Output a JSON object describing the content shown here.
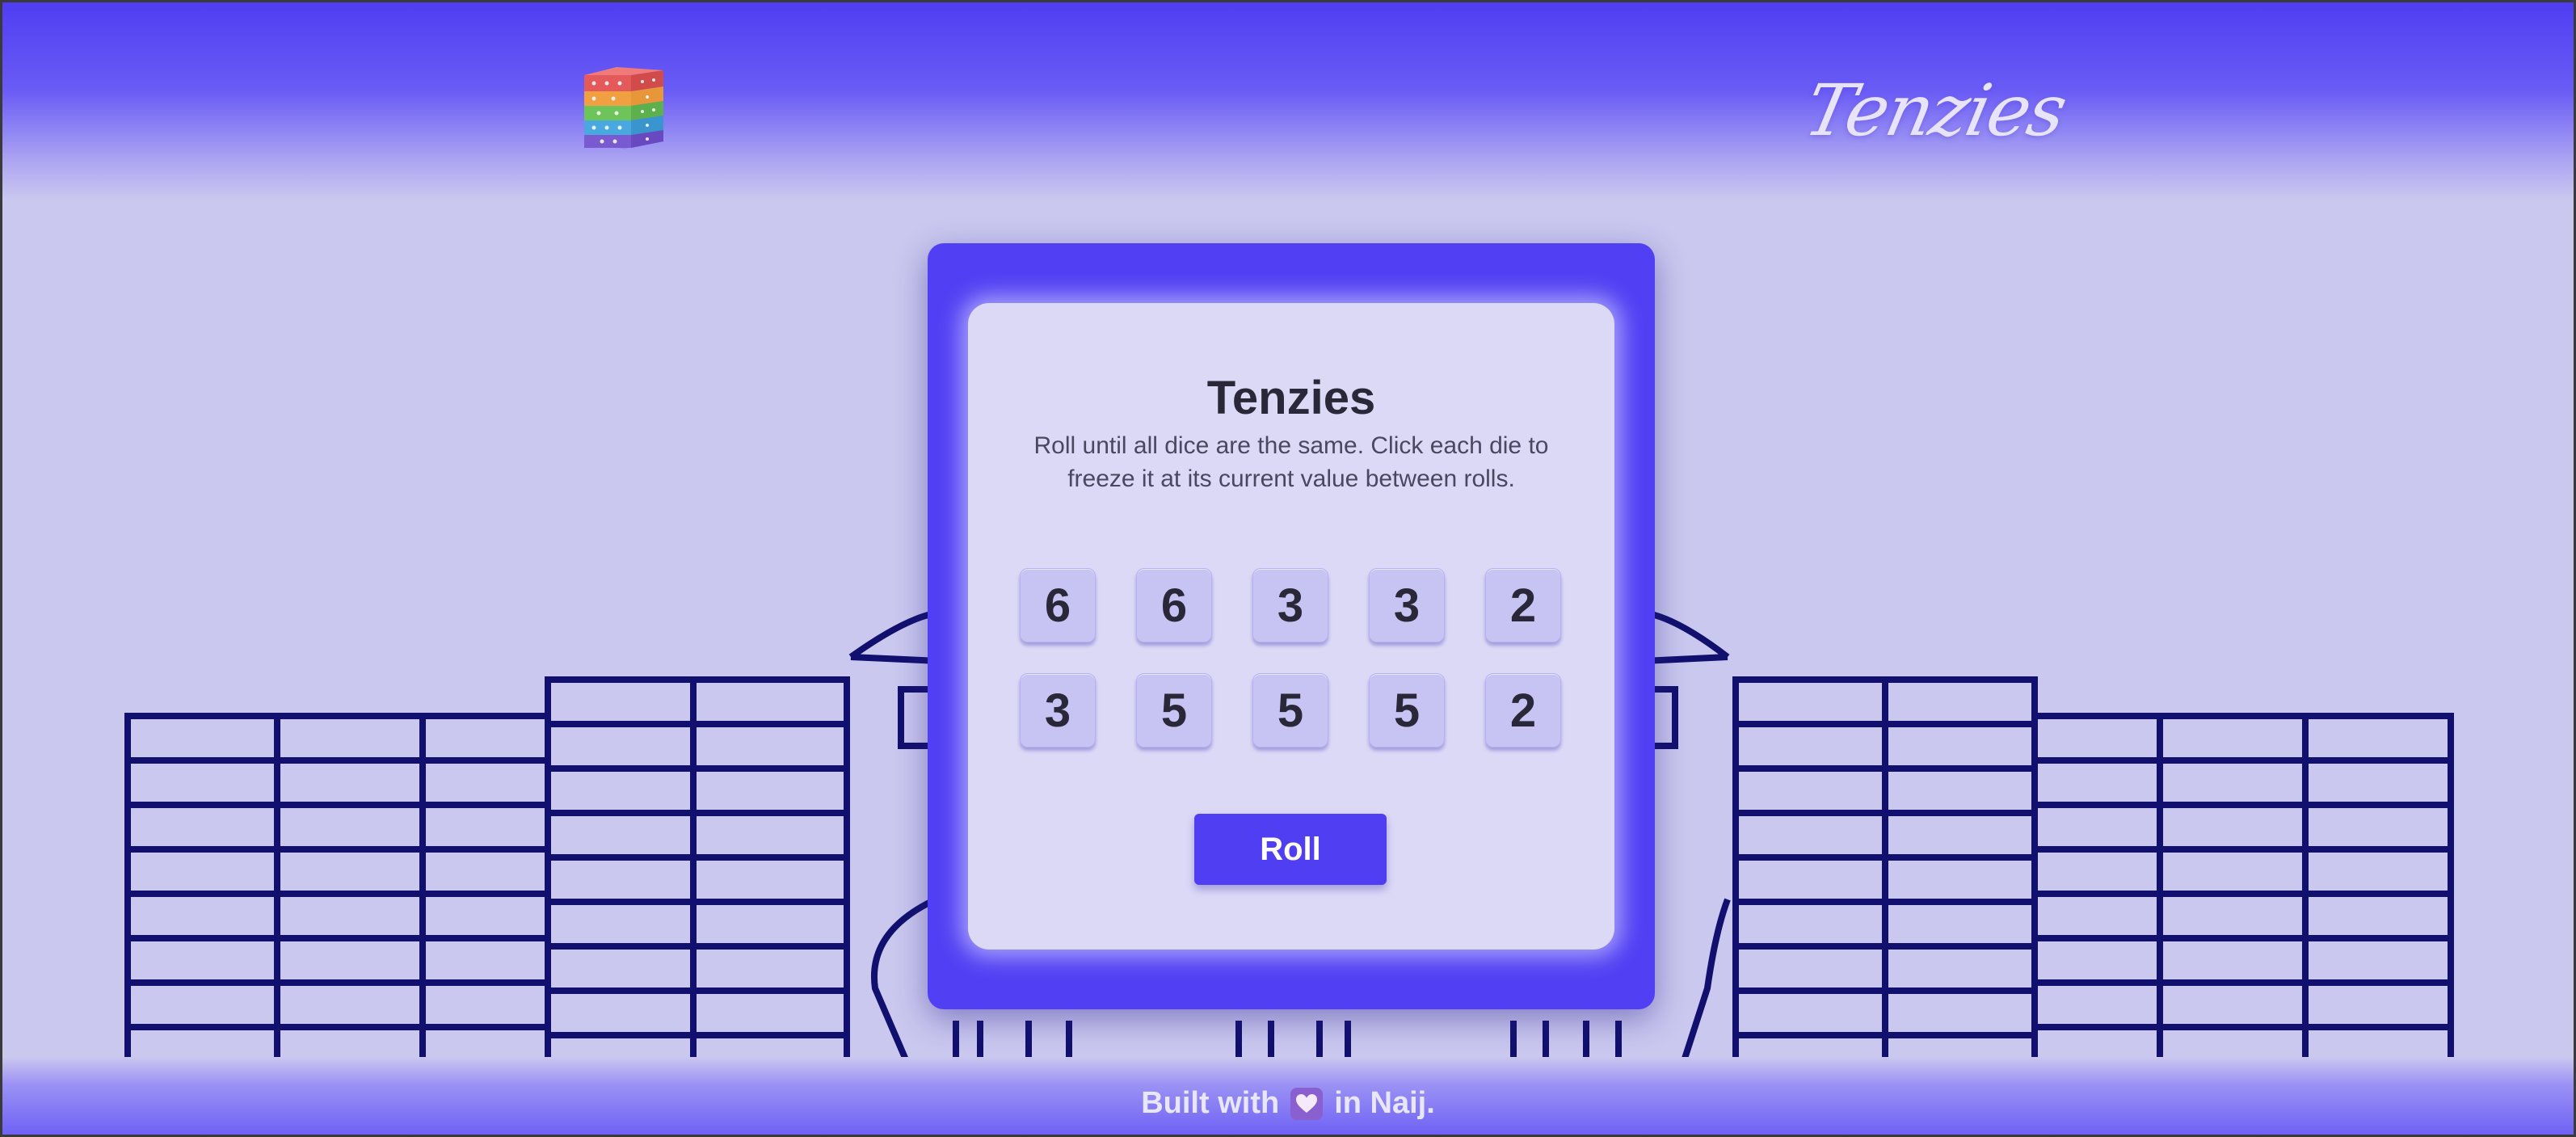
{
  "header": {
    "logo_icon": "dice-stack-icon",
    "brand_text": "Tenzies"
  },
  "game": {
    "title": "Tenzies",
    "description": "Roll until all dice are the same. Click each die to freeze it at its current value between rolls.",
    "dice": [
      "6",
      "6",
      "3",
      "3",
      "2",
      "3",
      "5",
      "5",
      "5",
      "2"
    ],
    "roll_label": "Roll"
  },
  "footer": {
    "prefix": "Built with",
    "heart_icon": "heart-icon",
    "suffix": "in Naij."
  },
  "colors": {
    "accent": "#5140f3",
    "background": "#cac8ef",
    "die_face": "#c7c3f3",
    "text_dark": "#2a2838"
  }
}
